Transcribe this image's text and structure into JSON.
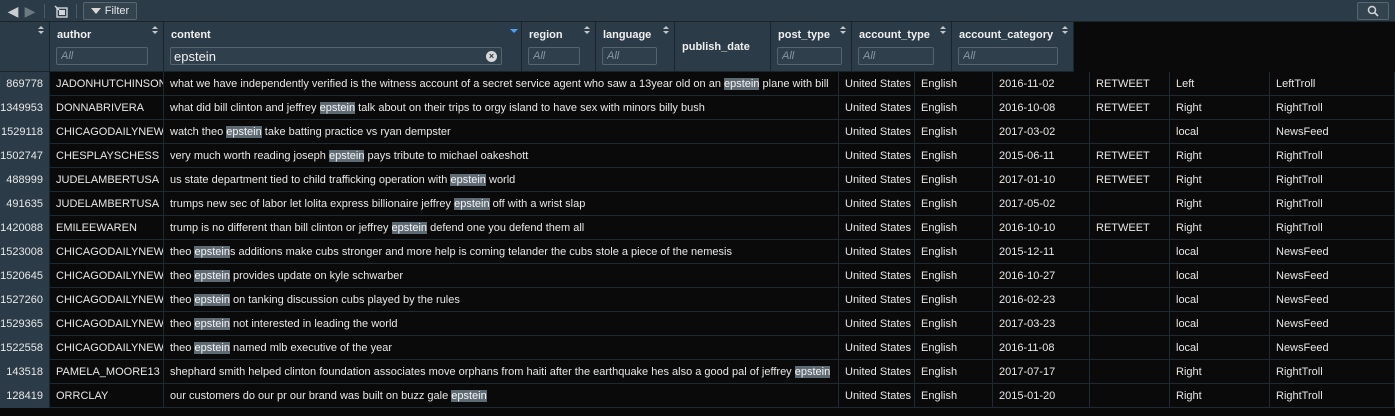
{
  "toolbar": {
    "back_icon": "arrow-left-icon",
    "forward_icon": "arrow-right-icon",
    "popout_icon": "popout-icon",
    "filter_label": "Filter",
    "search_icon": "search-icon"
  },
  "search_term": "epstein",
  "columns": [
    {
      "key": "author",
      "label": "author",
      "placeholder": "All",
      "value": ""
    },
    {
      "key": "content",
      "label": "content",
      "placeholder": "All",
      "value": "epstein"
    },
    {
      "key": "region",
      "label": "region",
      "placeholder": "All",
      "value": ""
    },
    {
      "key": "language",
      "label": "language",
      "placeholder": "All",
      "value": ""
    },
    {
      "key": "publish_date",
      "label": "publish_date",
      "placeholder": "",
      "value": ""
    },
    {
      "key": "post_type",
      "label": "post_type",
      "placeholder": "All",
      "value": ""
    },
    {
      "key": "account_type",
      "label": "account_type",
      "placeholder": "All",
      "value": ""
    },
    {
      "key": "account_category",
      "label": "account_category",
      "placeholder": "All",
      "value": ""
    }
  ],
  "rows": [
    {
      "id": "869778",
      "author": "JADONHUTCHINSON",
      "content": "what we have independently verified is the witness account of a secret service agent who saw a 13year old on an epstein plane with bill",
      "region": "United States",
      "language": "English",
      "publish_date": "2016-11-02",
      "post_type": "RETWEET",
      "account_type": "Left",
      "account_category": "LeftTroll"
    },
    {
      "id": "1349953",
      "author": "DONNABRIVERA",
      "content": "what did bill clinton and jeffrey epstein talk about on their trips to orgy island to have sex with minors    billy bush",
      "region": "United States",
      "language": "English",
      "publish_date": "2016-10-08",
      "post_type": "RETWEET",
      "account_type": "Right",
      "account_category": "RightTroll"
    },
    {
      "id": "1529118",
      "author": "CHICAGODAILYNEW",
      "content": "watch theo epstein take batting practice vs ryan dempster",
      "region": "United States",
      "language": "English",
      "publish_date": "2017-03-02",
      "post_type": "",
      "account_type": "local",
      "account_category": "NewsFeed"
    },
    {
      "id": "1502747",
      "author": "CHESPLAYSCHESS",
      "content": "very much worth reading joseph epstein pays tribute to michael oakeshott",
      "region": "United States",
      "language": "English",
      "publish_date": "2015-06-11",
      "post_type": "RETWEET",
      "account_type": "Right",
      "account_category": "RightTroll"
    },
    {
      "id": "488999",
      "author": "JUDELAMBERTUSA",
      "content": "us state department tied to child trafficking operation with epstein  world",
      "region": "United States",
      "language": "English",
      "publish_date": "2017-01-10",
      "post_type": "RETWEET",
      "account_type": "Right",
      "account_category": "RightTroll"
    },
    {
      "id": "491635",
      "author": "JUDELAMBERTUSA",
      "content": "trumps new sec of labor let lolita express billionaire jeffrey epstein off with a wrist slap",
      "region": "United States",
      "language": "English",
      "publish_date": "2017-05-02",
      "post_type": "",
      "account_type": "Right",
      "account_category": "RightTroll"
    },
    {
      "id": "1420088",
      "author": "EMILEEWAREN",
      "content": "trump is no different than bill clinton or jeffrey epstein defend one you defend them all",
      "region": "United States",
      "language": "English",
      "publish_date": "2016-10-10",
      "post_type": "RETWEET",
      "account_type": "Right",
      "account_category": "RightTroll"
    },
    {
      "id": "1523008",
      "author": "CHICAGODAILYNEW",
      "content": "theo epsteins additions make cubs stronger and more help is coming telander the cubs stole a piece of the nemesis",
      "region": "United States",
      "language": "English",
      "publish_date": "2015-12-11",
      "post_type": "",
      "account_type": "local",
      "account_category": "NewsFeed"
    },
    {
      "id": "1520645",
      "author": "CHICAGODAILYNEW",
      "content": "theo epstein provides update on kyle schwarber",
      "region": "United States",
      "language": "English",
      "publish_date": "2016-10-27",
      "post_type": "",
      "account_type": "local",
      "account_category": "NewsFeed"
    },
    {
      "id": "1527260",
      "author": "CHICAGODAILYNEW",
      "content": "theo epstein on tanking discussion cubs played by the rules",
      "region": "United States",
      "language": "English",
      "publish_date": "2016-02-23",
      "post_type": "",
      "account_type": "local",
      "account_category": "NewsFeed"
    },
    {
      "id": "1529365",
      "author": "CHICAGODAILYNEW",
      "content": "theo epstein not interested in leading the world",
      "region": "United States",
      "language": "English",
      "publish_date": "2017-03-23",
      "post_type": "",
      "account_type": "local",
      "account_category": "NewsFeed"
    },
    {
      "id": "1522558",
      "author": "CHICAGODAILYNEW",
      "content": "theo epstein named mlb executive of the year",
      "region": "United States",
      "language": "English",
      "publish_date": "2016-11-08",
      "post_type": "",
      "account_type": "local",
      "account_category": "NewsFeed"
    },
    {
      "id": "143518",
      "author": "PAMELA_MOORE13",
      "content": "shephard smith helped clinton foundation associates move orphans from haiti after the earthquake hes also a good pal of jeffrey epstein",
      "region": "United States",
      "language": "English",
      "publish_date": "2017-07-17",
      "post_type": "",
      "account_type": "Right",
      "account_category": "RightTroll"
    },
    {
      "id": "128419",
      "author": "ORRCLAY",
      "content": "our customers do our pr our brand was built on buzz  gale epstein",
      "region": "United States",
      "language": "English",
      "publish_date": "2015-01-20",
      "post_type": "",
      "account_type": "Right",
      "account_category": "RightTroll"
    }
  ]
}
